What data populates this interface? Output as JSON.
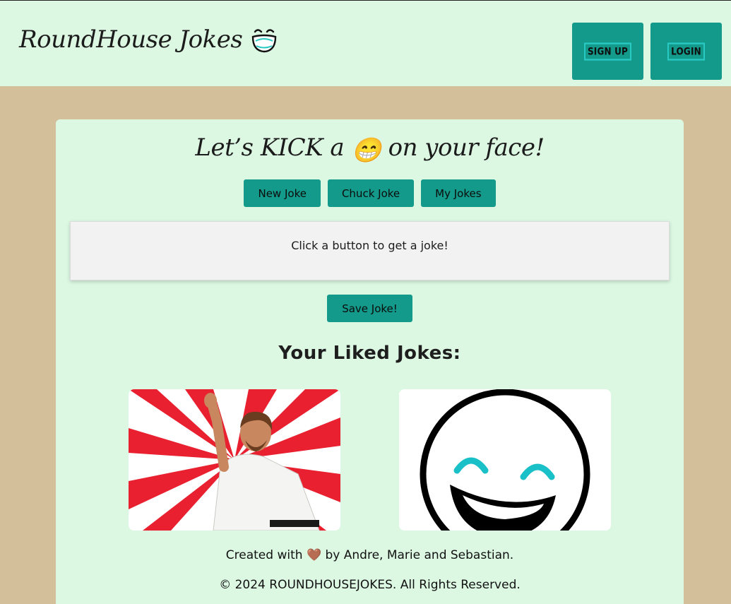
{
  "header": {
    "brand": "RoundHouse Jokes",
    "brand_icon": "laughing-face-icon",
    "signup_label": "SIGN UP",
    "login_label": "LOGIN"
  },
  "main": {
    "headline_before": "Let’s KICK a",
    "headline_emoji": "😁",
    "headline_after": "on your face!",
    "buttons": [
      {
        "label": "New Joke"
      },
      {
        "label": "Chuck Joke"
      },
      {
        "label": "My Jokes"
      }
    ],
    "joke_text": "Click a button to get a joke!",
    "save_label": "Save Joke!",
    "liked_title": "Your Liked Jokes:",
    "liked_images": [
      {
        "icon": "chuck-norris-photo-icon"
      },
      {
        "icon": "laughing-face-icon"
      }
    ]
  },
  "footer": {
    "credit_before": "Created with",
    "credit_heart": "🤎",
    "credit_after": "by Andre, Marie and Sebastian.",
    "copyright": "© 2024 ROUNDHOUSEJOKES. All Rights Reserved."
  },
  "colors": {
    "page_bg": "#d3bf9a",
    "panel_bg": "#dcf8e3",
    "button": "#139a8a",
    "accent_cyan": "#29c9c4"
  }
}
